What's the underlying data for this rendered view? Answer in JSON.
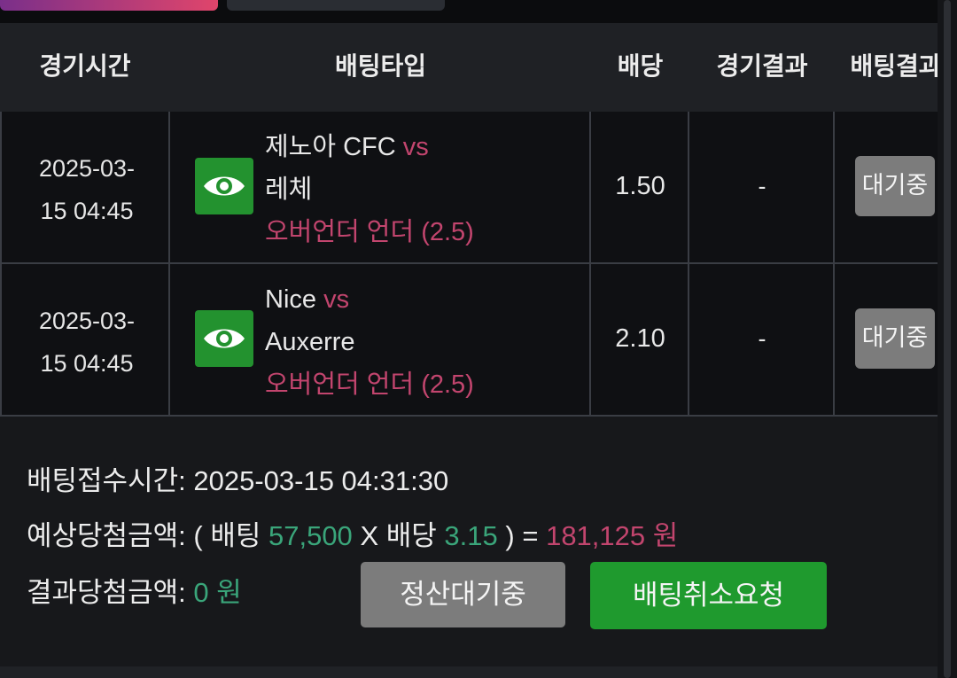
{
  "header": {
    "col_time": "경기시간",
    "col_type": "배팅타입",
    "col_odds": "배당",
    "col_match_result": "경기결과",
    "col_bet_result": "배팅결과"
  },
  "rows": [
    {
      "time_line1": "2025-03-",
      "time_line2": "15 04:45",
      "home": "제노아 CFC",
      "vs": "vs",
      "away": "레체",
      "market": "오버언더 언더 (2.5)",
      "odds": "1.50",
      "match_result": "-",
      "bet_status": "대기중",
      "icon": "eye-icon"
    },
    {
      "time_line1": "2025-03-",
      "time_line2": "15 04:45",
      "home": "Nice",
      "vs": "vs",
      "away": "Auxerre",
      "market": "오버언더 언더 (2.5)",
      "odds": "2.10",
      "match_result": "-",
      "bet_status": "대기중",
      "icon": "eye-icon"
    }
  ],
  "summary": {
    "accept_label": "배팅접수시간:",
    "accept_time": "2025-03-15 04:31:30",
    "expected_label": "예상당첨금액:",
    "open_paren": "(",
    "bet_word": "배팅",
    "bet_amount": "57,500",
    "times": "X",
    "odds_word": "배당",
    "total_odds": "3.15",
    "close_paren": ")",
    "equals": "=",
    "expected_amount": "181,125 원",
    "result_label": "결과당첨금액:",
    "result_amount": "0 원"
  },
  "actions": {
    "settle_label": "정산대기중",
    "cancel_label": "배팅취소요청"
  },
  "colors": {
    "accent_pink": "#c2456e",
    "accent_green_text": "#3aa57a",
    "button_green": "#1f9a2e",
    "button_gray": "#7c7c7c"
  }
}
